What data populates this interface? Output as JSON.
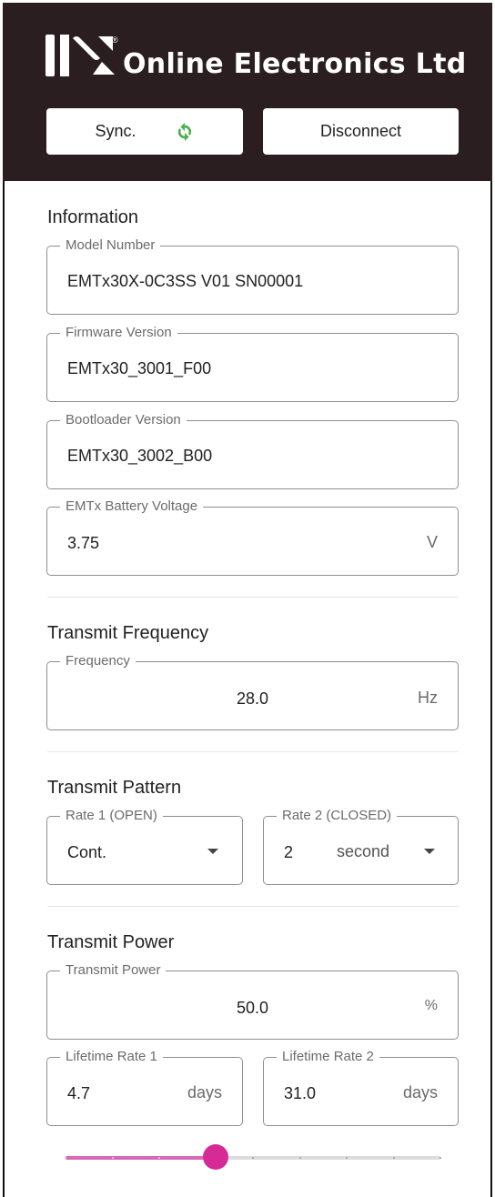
{
  "header": {
    "company_name": "Online Electronics Ltd",
    "registered_mark": "®",
    "sync_label": "Sync.",
    "disconnect_label": "Disconnect",
    "sync_icon": "refresh-icon",
    "sync_icon_color": "#4caf50",
    "background_color": "#2a1e20"
  },
  "information": {
    "title": "Information",
    "model_number": {
      "label": "Model Number",
      "value": "EMTx30X-0C3SS V01 SN00001"
    },
    "firmware_version": {
      "label": "Firmware Version",
      "value": "EMTx30_3001_F00"
    },
    "bootloader_version": {
      "label": "Bootloader Version",
      "value": "EMTx30_3002_B00"
    },
    "battery_voltage": {
      "label": "EMTx Battery Voltage",
      "value": "3.75",
      "unit": "V"
    }
  },
  "transmit_frequency": {
    "title": "Transmit Frequency",
    "frequency": {
      "label": "Frequency",
      "value": "28.0",
      "unit": "Hz"
    }
  },
  "transmit_pattern": {
    "title": "Transmit Pattern",
    "rate1": {
      "label": "Rate 1 (OPEN)",
      "value": "Cont."
    },
    "rate2": {
      "label": "Rate 2 (CLOSED)",
      "value": "2",
      "unit": "second"
    }
  },
  "transmit_power": {
    "title": "Transmit Power",
    "power": {
      "label": "Transmit Power",
      "value": "50.0",
      "unit": "%"
    },
    "lifetime_rate1": {
      "label": "Lifetime Rate 1",
      "value": "4.7",
      "unit": "days"
    },
    "lifetime_rate2": {
      "label": "Lifetime Rate 2",
      "value": "31.0",
      "unit": "days"
    },
    "slider": {
      "value_fraction": 0.4,
      "steps": 9,
      "accent_color": "#d62a97"
    }
  }
}
